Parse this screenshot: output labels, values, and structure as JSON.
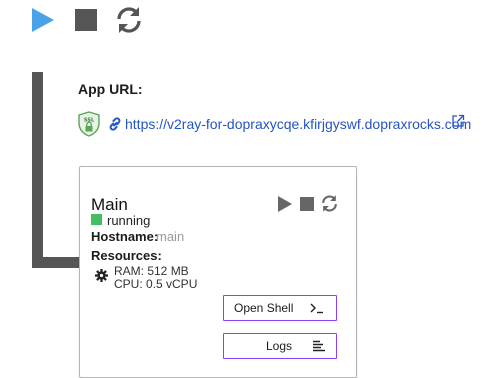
{
  "toolbar": {
    "play_icon": "play-icon",
    "stop_icon": "stop-icon",
    "restart_icon": "restart-icon"
  },
  "app_url": {
    "label": "App URL:",
    "ssl_badge_text": "SSL",
    "url": "https://v2ray-for-dopraxycqe.kfirjgyswf.dopraxrocks.com"
  },
  "service": {
    "name": "Main",
    "status": "running",
    "hostname_label": "Hostname:",
    "hostname": "main",
    "resources_label": "Resources:",
    "ram": "RAM: 512 MB",
    "cpu": "CPU: 0.5 vCPU",
    "open_shell_label": "Open Shell",
    "logs_label": "Logs"
  },
  "colors": {
    "accent_blue": "#4aa3e8",
    "link_blue": "#2554c7",
    "status_green": "#42be65",
    "button_border_purple": "#8a3ffc",
    "icon_gray": "#555555",
    "ssl_green": "#5aa55a"
  }
}
